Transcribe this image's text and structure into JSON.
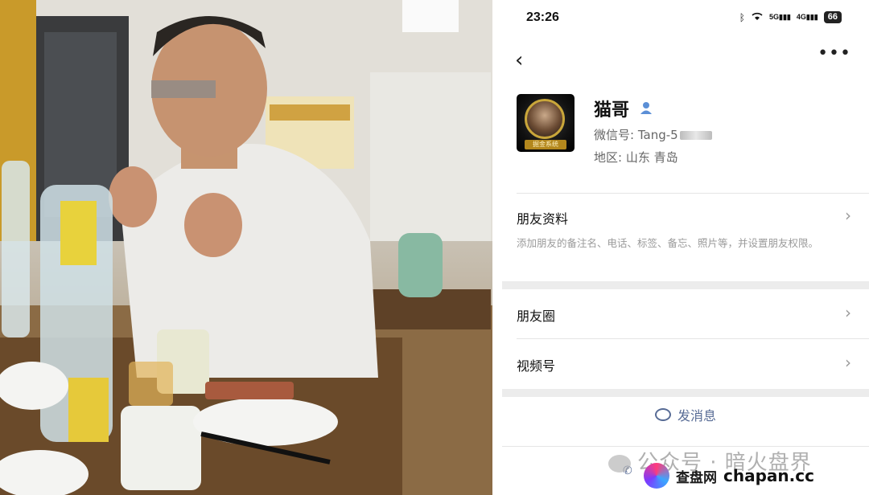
{
  "status_bar": {
    "time": "23:26",
    "net1": "5G",
    "net2": "4G",
    "battery": "66"
  },
  "nav": {
    "back_icon": "chevron-left-icon",
    "more_icon": "more-dots-icon"
  },
  "profile": {
    "nickname": "猫哥",
    "avatar_tag": "掘金系统",
    "wechat_id_label": "微信号: Tang-5",
    "region": "地区: 山东  青岛",
    "gender_icon": "user-male-icon"
  },
  "rows": {
    "friend_profile": {
      "title": "朋友资料",
      "desc": "添加朋友的备注名、电话、标签、备忘、照片等，并设置朋友权限。"
    },
    "moments": {
      "title": "朋友圈"
    },
    "channels": {
      "title": "视频号"
    }
  },
  "actions": {
    "send_message": "发消息"
  },
  "watermarks": {
    "official_account": "公众号 · 暗火盘界",
    "site_cn": "查盘网",
    "site_domain": "chapan.cc"
  },
  "colors": {
    "link_blue": "#576b95",
    "text_primary": "#111111",
    "text_secondary": "#666666",
    "separator": "#ececec"
  }
}
